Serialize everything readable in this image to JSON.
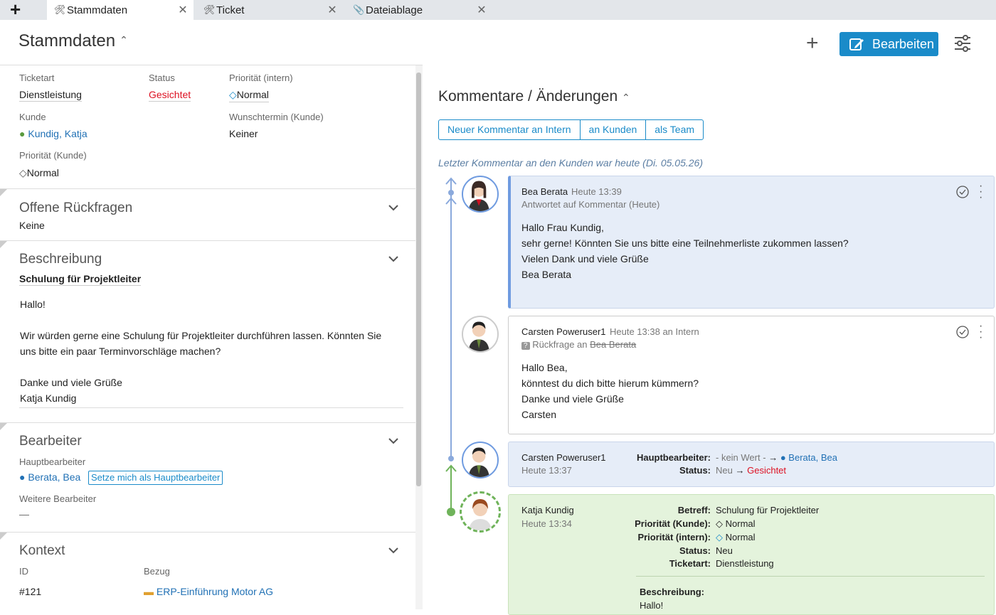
{
  "tabs": [
    {
      "label": "Stammdaten",
      "icon": "tools-icon"
    },
    {
      "label": "Ticket",
      "icon": "tools-icon"
    },
    {
      "label": "Dateiablage",
      "icon": "paperclip-icon"
    }
  ],
  "header": {
    "title": "Stammdaten",
    "edit_label": "Bearbeiten"
  },
  "details": {
    "ticketart_label": "Ticketart",
    "ticketart": "Dienstleistung",
    "status_label": "Status",
    "status": "Gesichtet",
    "prio_intern_label": "Priorität (intern)",
    "prio_intern": "Normal",
    "kunde_label": "Kunde",
    "kunde": "Kundig, Katja",
    "wunschtermin_label": "Wunschtermin (Kunde)",
    "wunschtermin": "Keiner",
    "prio_kunde_label": "Priorität (Kunde)",
    "prio_kunde": "Normal"
  },
  "rueckfragen": {
    "title": "Offene Rückfragen",
    "value": "Keine"
  },
  "beschreibung": {
    "title": "Beschreibung",
    "subject": "Schulung für Projektleiter",
    "lines": [
      "Hallo!",
      "",
      "Wir würden gerne eine Schulung für Projektleiter durchführen lassen. Könnten Sie",
      "uns bitte ein paar Terminvorschläge machen?",
      "",
      "Danke und viele Grüße",
      "Katja Kundig"
    ]
  },
  "bearbeiter": {
    "title": "Bearbeiter",
    "haupt_label": "Hauptbearbeiter",
    "haupt": "Berata, Bea",
    "setze_label": "Setze mich als Hauptbearbeiter",
    "weitere_label": "Weitere Bearbeiter",
    "weitere": "—"
  },
  "kontext": {
    "title": "Kontext",
    "id_label": "ID",
    "id": "#121",
    "bezug_label": "Bezug",
    "bezug": "ERP-Einführung Motor AG"
  },
  "comments": {
    "title": "Kommentare / Änderungen",
    "buttons": [
      "Neuer Kommentar an Intern",
      "an Kunden",
      "als Team"
    ],
    "last_note": "Letzter Kommentar an den Kunden war heute (Di. 05.05.26)",
    "c1": {
      "author": "Bea Berata",
      "time": "Heute 13:39",
      "meta": "Antwortet auf Kommentar (Heute)",
      "lines": [
        "Hallo Frau Kundig,",
        "sehr gerne! Könnten Sie uns bitte eine Teilnehmerliste zukommen lassen?",
        "Vielen Dank und viele Grüße",
        "Bea Berata"
      ]
    },
    "c2": {
      "author": "Carsten Poweruser1",
      "time": "Heute 13:38 an Intern",
      "meta_prefix": "Rückfrage an",
      "meta_person": "Bea Berata",
      "lines": [
        "Hallo Bea,",
        "könntest du dich bitte hierum kümmern?",
        "Danke und viele Grüße",
        "Carsten"
      ]
    },
    "c3": {
      "author": "Carsten Poweruser1",
      "time": "Heute 13:37",
      "k1": "Hauptbearbeiter:",
      "old1": "- kein Wert -",
      "new1": "Berata, Bea",
      "k2": "Status:",
      "old2": "Neu",
      "new2": "Gesichtet"
    },
    "c4": {
      "author": "Katja Kundig",
      "time": "Heute 13:34",
      "rows": [
        {
          "k": "Betreff:",
          "v": "Schulung für Projektleiter"
        },
        {
          "k": "Priorität (Kunde):",
          "v": "Normal"
        },
        {
          "k": "Priorität (intern):",
          "v": "Normal"
        },
        {
          "k": "Status:",
          "v": "Neu"
        },
        {
          "k": "Ticketart:",
          "v": "Dienstleistung"
        }
      ],
      "desc_label": "Beschreibung:",
      "desc_first": "Hallo!"
    }
  }
}
